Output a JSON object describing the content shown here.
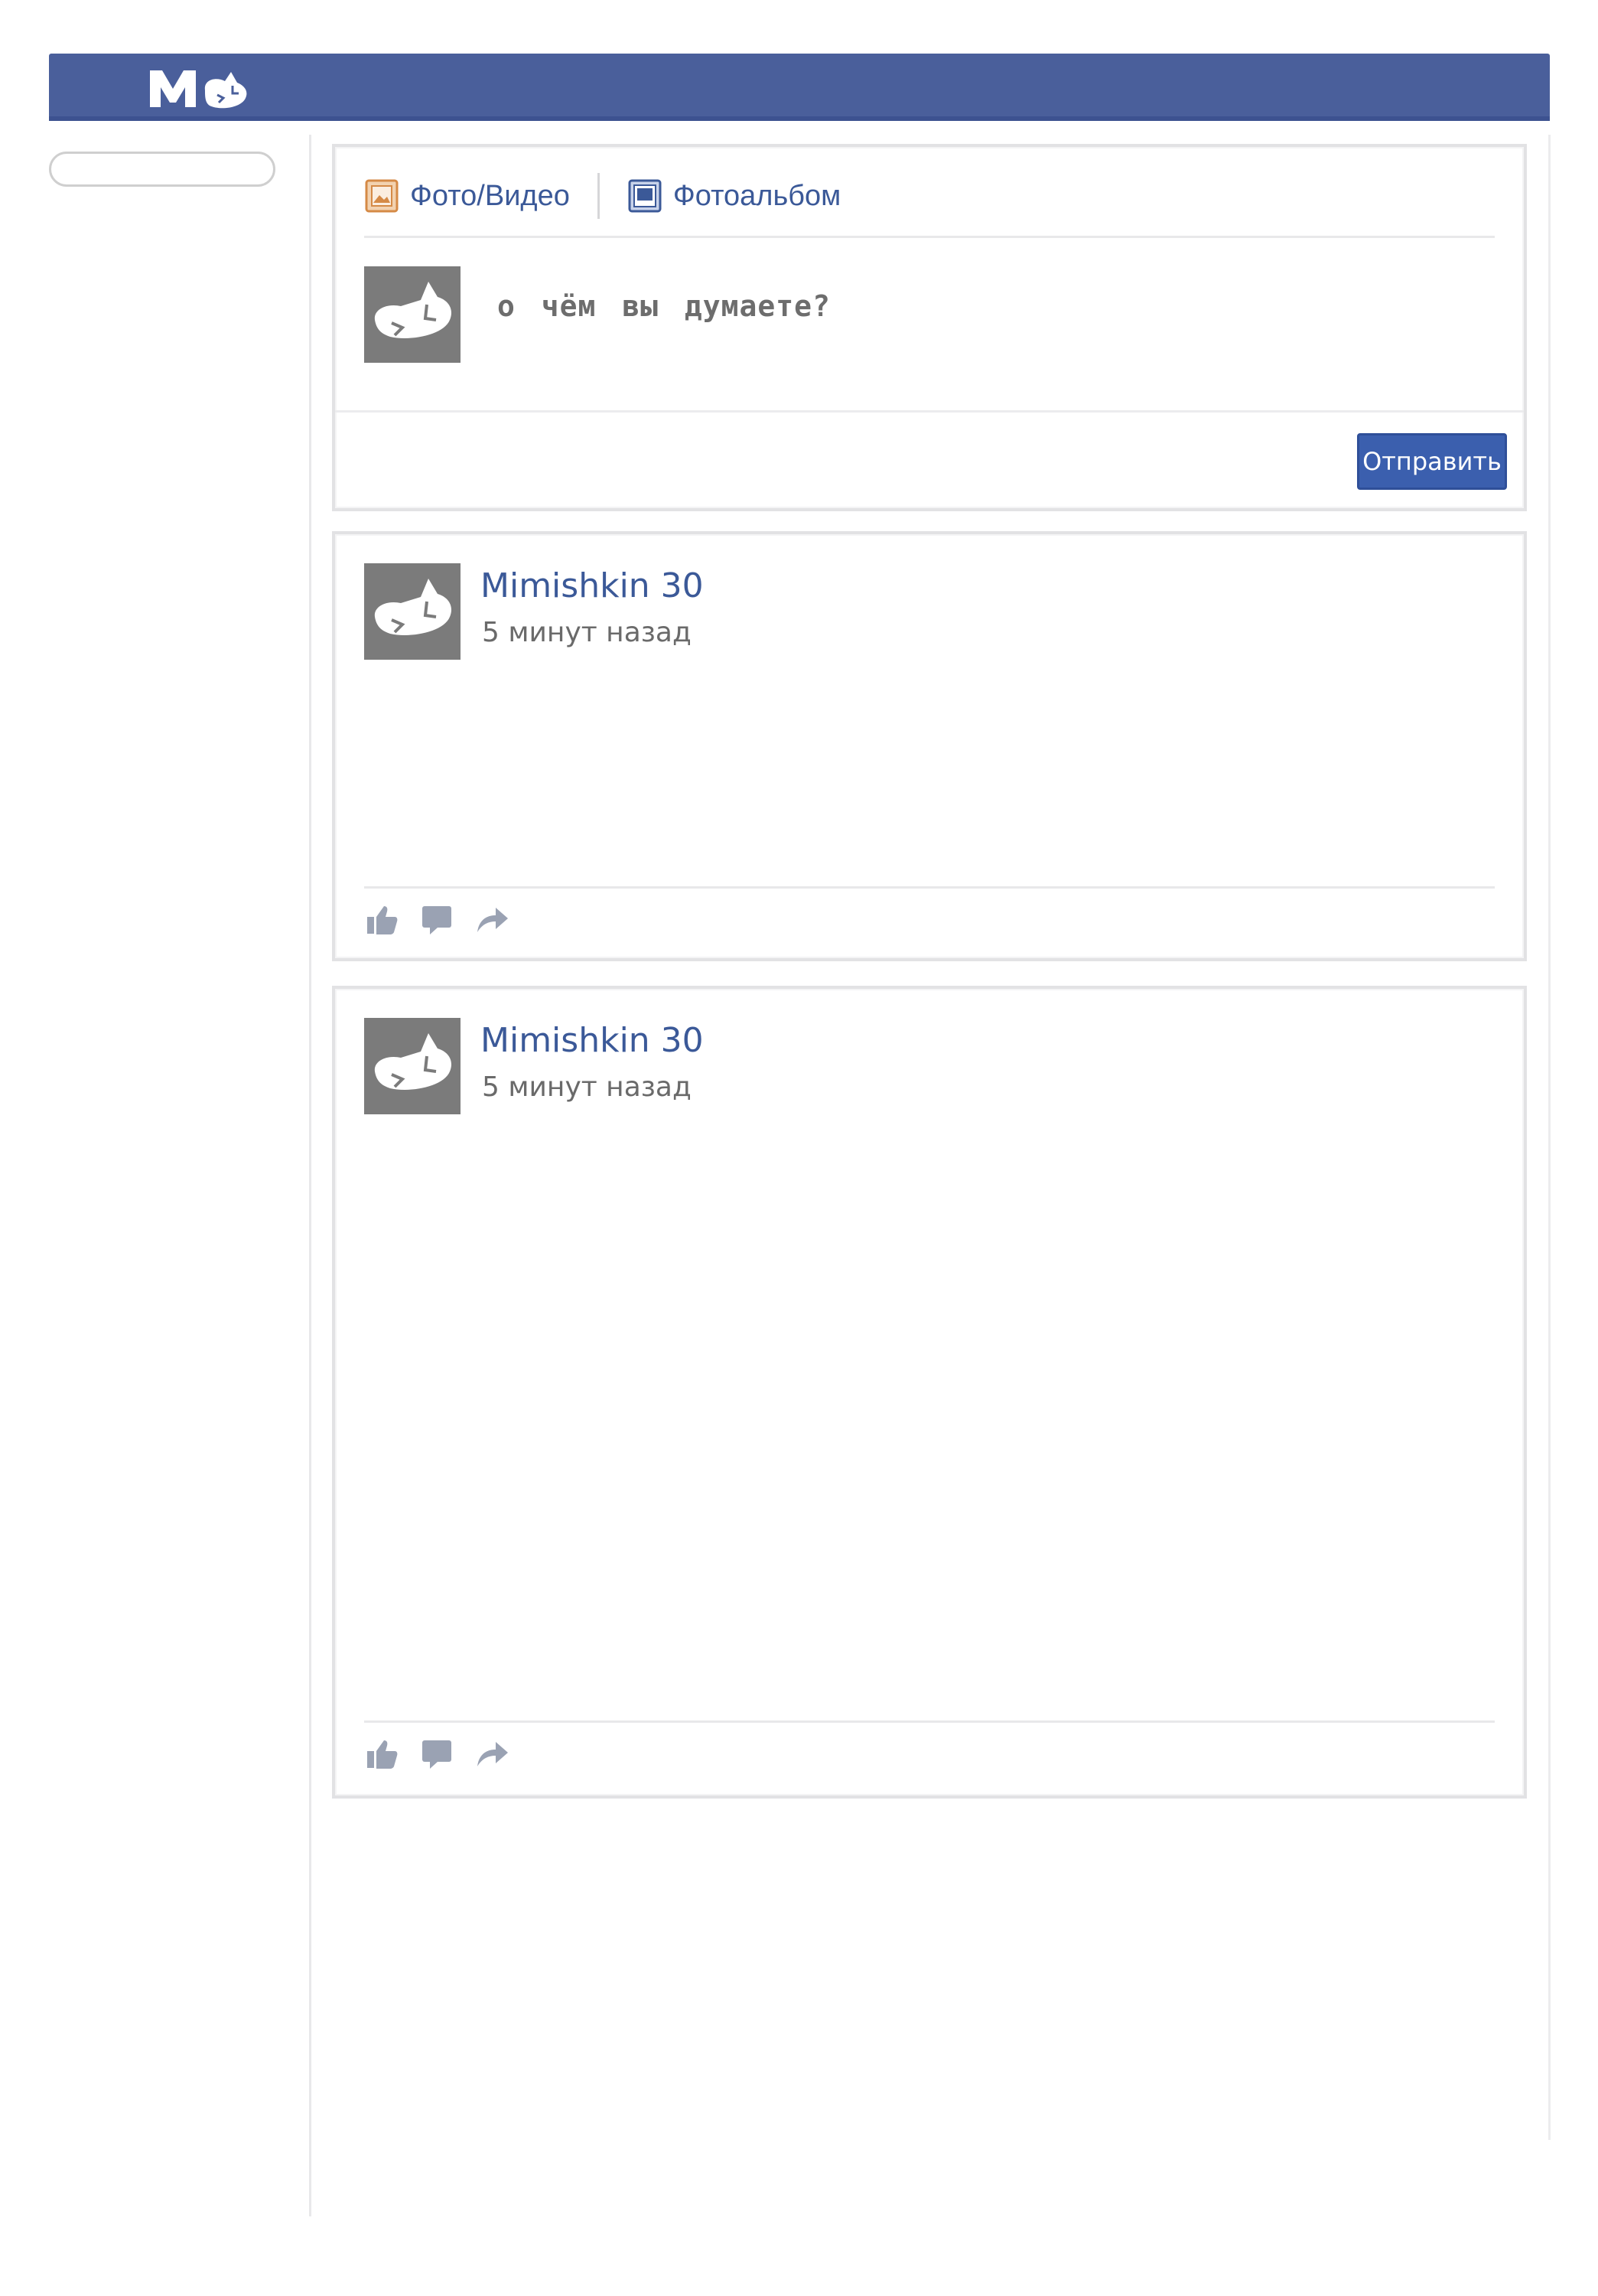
{
  "header": {
    "logo_icon": "cat-mask-icon",
    "brand_color": "#4a5f9b"
  },
  "composer": {
    "tab_photo_video": "Фото/Видео",
    "tab_photo_album": "Фотоальбом",
    "prompt": "о чём вы думаете?",
    "send_label": "Отправить"
  },
  "posts": [
    {
      "author": "Mimishkin 30",
      "time": "5 минут назад"
    },
    {
      "author": "Mimishkin 30",
      "time": "5 минут назад"
    }
  ],
  "icons": {
    "like": "thumbs-up-icon",
    "comment": "comment-icon",
    "share": "share-arrow-icon",
    "photo": "photo-video-icon",
    "album": "photo-album-icon"
  },
  "colors": {
    "link": "#3b5998",
    "button": "#3b5fae",
    "avatar_bg": "#7b7b7b"
  }
}
